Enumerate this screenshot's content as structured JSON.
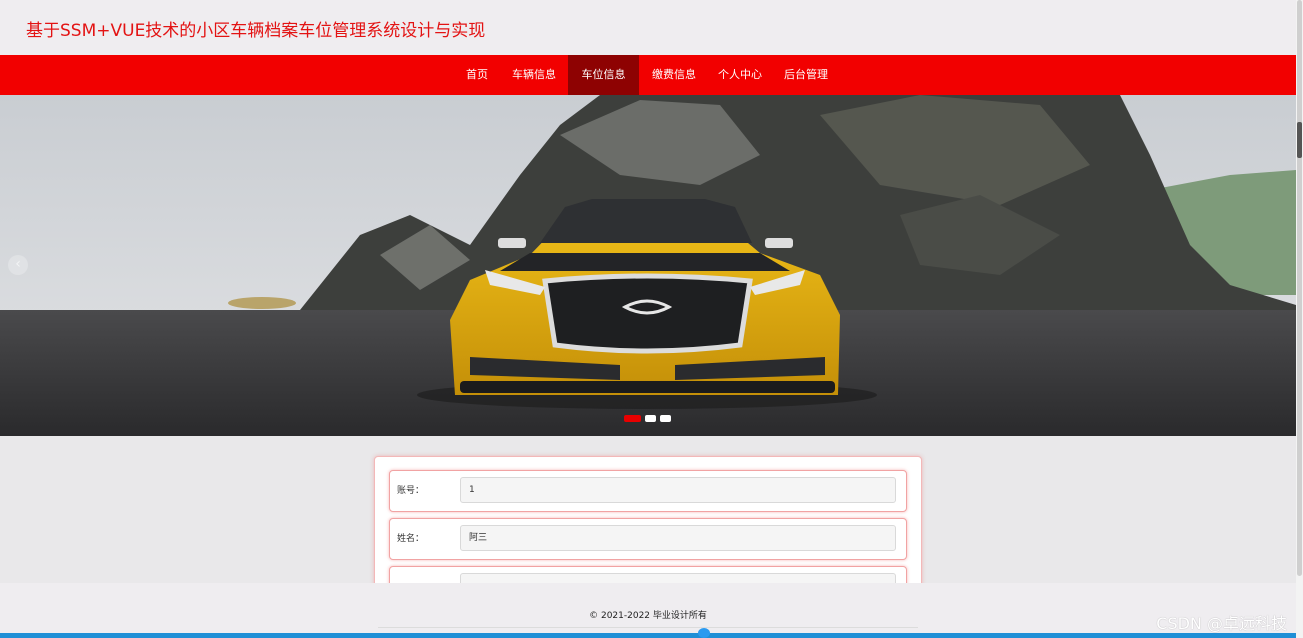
{
  "header": {
    "title": "基于SSM+VUE技术的小区车辆档案车位管理系统设计与实现"
  },
  "nav": {
    "items": [
      {
        "label": "首页"
      },
      {
        "label": "车辆信息"
      },
      {
        "label": "车位信息",
        "active": true
      },
      {
        "label": "缴费信息"
      },
      {
        "label": "个人中心"
      },
      {
        "label": "后台管理"
      }
    ]
  },
  "banner": {
    "prev_icon": "chevron-left-icon",
    "slides": 3,
    "active_slide": 1
  },
  "form": {
    "fields": [
      {
        "label": "账号：",
        "value": "1"
      },
      {
        "label": "姓名：",
        "value": "阿三"
      }
    ]
  },
  "footer": {
    "copyright": "© 2021-2022 毕业设计所有"
  },
  "watermark": "CSDN @卓远科技",
  "colors": {
    "accent": "#f20000",
    "active_nav": "#8e0202",
    "title": "#e31313"
  }
}
